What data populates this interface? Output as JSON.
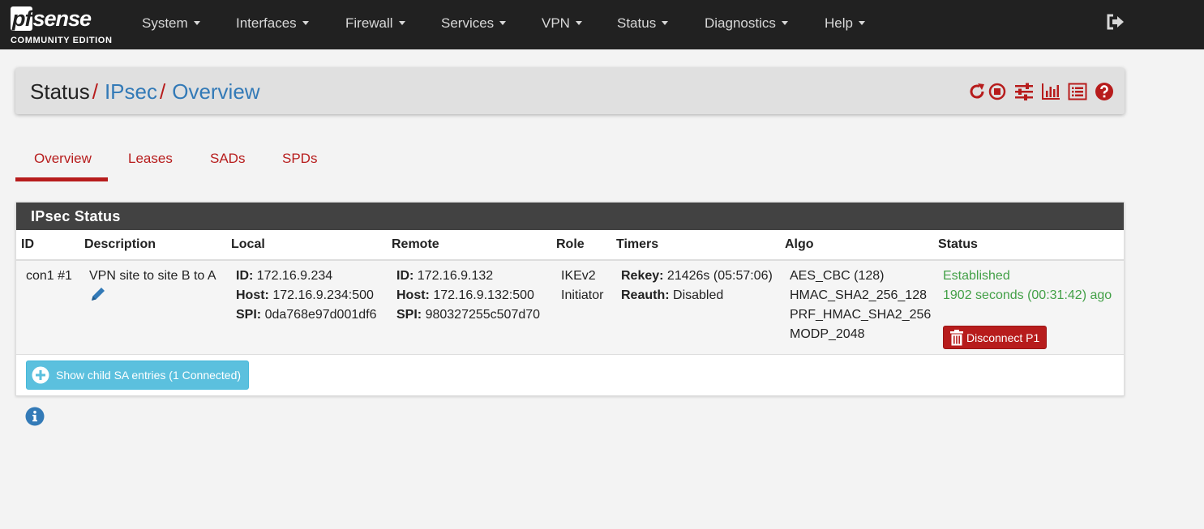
{
  "brand": {
    "logo_text": "pfsense",
    "edition": "COMMUNITY EDITION"
  },
  "nav": {
    "items": [
      {
        "label": "System"
      },
      {
        "label": "Interfaces"
      },
      {
        "label": "Firewall"
      },
      {
        "label": "Services"
      },
      {
        "label": "VPN"
      },
      {
        "label": "Status"
      },
      {
        "label": "Diagnostics"
      },
      {
        "label": "Help"
      }
    ]
  },
  "breadcrumb": {
    "root": "Status",
    "sep": "/",
    "level1": "IPsec",
    "level2": "Overview"
  },
  "header_icons": [
    "reload-icon",
    "stop-icon",
    "settings-sliders-icon",
    "bar-chart-icon",
    "log-list-icon",
    "help-icon"
  ],
  "tabs": [
    {
      "label": "Overview",
      "active": true
    },
    {
      "label": "Leases",
      "active": false
    },
    {
      "label": "SADs",
      "active": false
    },
    {
      "label": "SPDs",
      "active": false
    }
  ],
  "panel": {
    "title": "IPsec Status",
    "columns": [
      "ID",
      "Description",
      "Local",
      "Remote",
      "Role",
      "Timers",
      "Algo",
      "Status"
    ],
    "row": {
      "id": "con1 #1",
      "description": "VPN site to site B to A",
      "local": {
        "id_label": "ID:",
        "id_value": " 172.16.9.234",
        "host_label": "Host:",
        "host_value": " 172.16.9.234:500",
        "spi_label": "SPI:",
        "spi_value": " 0da768e97d001df6"
      },
      "remote": {
        "id_label": "ID:",
        "id_value": " 172.16.9.132",
        "host_label": "Host:",
        "host_value": " 172.16.9.132:500",
        "spi_label": "SPI:",
        "spi_value": " 980327255c507d70"
      },
      "role": [
        "IKEv2",
        "Initiator"
      ],
      "timers": {
        "rekey_label": "Rekey:",
        "rekey_value": " 21426s (05:57:06)",
        "reauth_label": "Reauth:",
        "reauth_value": " Disabled"
      },
      "algo": [
        "AES_CBC (128)",
        "HMAC_SHA2_256_128",
        "PRF_HMAC_SHA2_256",
        "MODP_2048"
      ],
      "status": [
        "Established",
        "1902 seconds (00:31:42) ago"
      ],
      "disconnect_label": "Disconnect P1"
    },
    "child_button_label": "Show child SA entries (1 Connected)"
  },
  "colors": {
    "navbar": "#212121",
    "accent_red": "#b71c1c",
    "link_blue": "#337ab7",
    "panel_heading": "#424242",
    "status_green": "#43a047",
    "info_button": "#5bc0de"
  }
}
